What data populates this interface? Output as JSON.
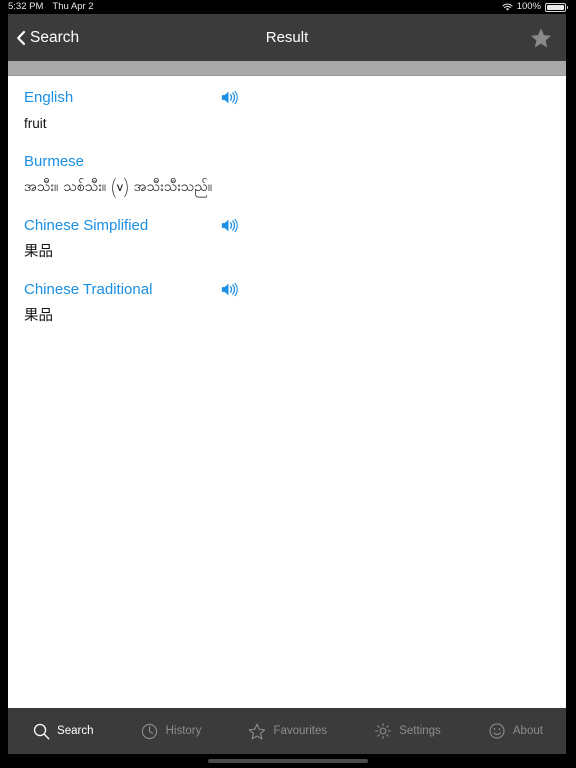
{
  "status_bar": {
    "time": "5:32 PM",
    "date": "Thu Apr 2",
    "battery_percent": "100%",
    "wifi_icon": "wifi-icon",
    "battery_icon": "battery-icon"
  },
  "nav_bar": {
    "back_label": "Search",
    "back_icon": "chevron-left-icon",
    "title": "Result",
    "favourite_icon": "star-filled-icon"
  },
  "entries": [
    {
      "language": "English",
      "value": "fruit",
      "has_speaker": true,
      "speaker_icon": "speaker-icon",
      "script": "latin"
    },
    {
      "language": "Burmese",
      "value": "အသီး။ သစ်သီး။ (v) အသီးသီးသည်။",
      "has_speaker": false,
      "speaker_icon": "",
      "script": "burmese"
    },
    {
      "language": "Chinese Simplified",
      "value": "果品",
      "has_speaker": true,
      "speaker_icon": "speaker-icon",
      "script": "cjk"
    },
    {
      "language": "Chinese Traditional",
      "value": "果品",
      "has_speaker": true,
      "speaker_icon": "speaker-icon",
      "script": "cjk"
    }
  ],
  "tab_bar": {
    "items": [
      {
        "label": "Search",
        "icon": "magnifier-icon",
        "active": true
      },
      {
        "label": "History",
        "icon": "clock-icon",
        "active": false
      },
      {
        "label": "Favourites",
        "icon": "star-outline-icon",
        "active": false
      },
      {
        "label": "Settings",
        "icon": "gear-icon",
        "active": false
      },
      {
        "label": "About",
        "icon": "smiley-icon",
        "active": false
      }
    ]
  },
  "colors": {
    "accent_blue": "#1a8fe3",
    "nav_background": "#3b3b3b",
    "strip_gray": "#a9a9a9",
    "content_background": "#ffffff",
    "tab_inactive": "#8d8d8d"
  }
}
